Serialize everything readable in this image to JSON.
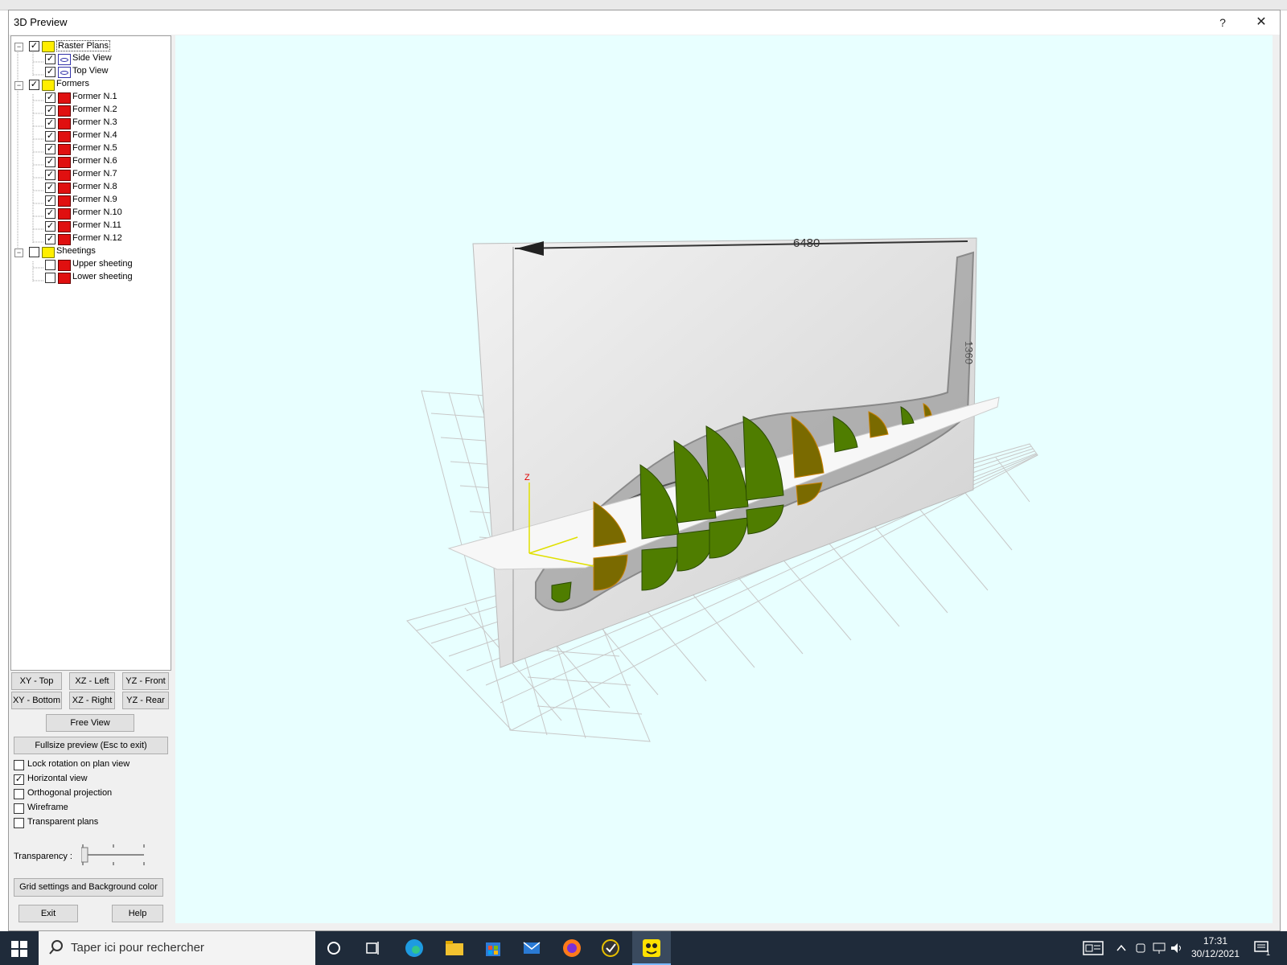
{
  "window": {
    "title": "3D Preview",
    "help_label": "?",
    "close_label": "✕"
  },
  "tree": {
    "items": [
      {
        "label": "Raster Plans",
        "level": 0,
        "checked": true,
        "icon": "folder-icon",
        "expander": "−",
        "selected": true
      },
      {
        "label": "Side View",
        "level": 1,
        "checked": true,
        "icon": "plan-icon"
      },
      {
        "label": "Top View",
        "level": 1,
        "checked": true,
        "icon": "plan-icon"
      },
      {
        "label": "Formers",
        "level": 0,
        "checked": true,
        "icon": "folder-icon",
        "expander": "−"
      },
      {
        "label": "Former N.1",
        "level": 1,
        "checked": true,
        "icon": "former-icon"
      },
      {
        "label": "Former N.2",
        "level": 1,
        "checked": true,
        "icon": "former-icon"
      },
      {
        "label": "Former N.3",
        "level": 1,
        "checked": true,
        "icon": "former-icon"
      },
      {
        "label": "Former N.4",
        "level": 1,
        "checked": true,
        "icon": "former-icon"
      },
      {
        "label": "Former N.5",
        "level": 1,
        "checked": true,
        "icon": "former-icon"
      },
      {
        "label": "Former N.6",
        "level": 1,
        "checked": true,
        "icon": "former-icon"
      },
      {
        "label": "Former N.7",
        "level": 1,
        "checked": true,
        "icon": "former-icon"
      },
      {
        "label": "Former N.8",
        "level": 1,
        "checked": true,
        "icon": "former-icon"
      },
      {
        "label": "Former N.9",
        "level": 1,
        "checked": true,
        "icon": "former-icon"
      },
      {
        "label": "Former N.10",
        "level": 1,
        "checked": true,
        "icon": "former-icon"
      },
      {
        "label": "Former N.11",
        "level": 1,
        "checked": true,
        "icon": "former-icon"
      },
      {
        "label": "Former N.12",
        "level": 1,
        "checked": true,
        "icon": "former-icon"
      },
      {
        "label": "Sheetings",
        "level": 0,
        "checked": false,
        "icon": "folder-icon",
        "expander": "−"
      },
      {
        "label": "Upper sheeting",
        "level": 1,
        "checked": false,
        "icon": "former-icon"
      },
      {
        "label": "Lower sheeting",
        "level": 1,
        "checked": false,
        "icon": "former-icon"
      }
    ]
  },
  "view_buttons": {
    "xy_top": "XY - Top",
    "xz_left": "XZ - Left",
    "yz_front": "YZ - Front",
    "xy_bottom": "XY - Bottom",
    "xz_right": "XZ - Right",
    "yz_rear": "YZ - Rear",
    "free_view": "Free View",
    "fullsize": "Fullsize preview (Esc to exit)"
  },
  "options": [
    {
      "label": "Lock rotation on plan view",
      "checked": false
    },
    {
      "label": "Horizontal view",
      "checked": true
    },
    {
      "label": "Orthogonal projection",
      "checked": false
    },
    {
      "label": "Wireframe",
      "checked": false
    },
    {
      "label": "Transparent plans",
      "checked": false
    }
  ],
  "transparency": {
    "label": "Transparency :",
    "value": 0.0
  },
  "bottom_buttons": {
    "grid_settings": "Grid settings and Background color",
    "exit": "Exit",
    "help": "Help"
  },
  "viewport": {
    "background": "#e8ffff",
    "plan_dimension_top": "6480",
    "plan_dimension_side": "1360",
    "axis_label_z": "Z",
    "former_colors": [
      "#4f7d00",
      "#7a6a00"
    ]
  },
  "taskbar": {
    "search_placeholder": "Taper ici pour rechercher",
    "time": "17:31",
    "date": "30/12/2021",
    "notification_count": "1"
  }
}
